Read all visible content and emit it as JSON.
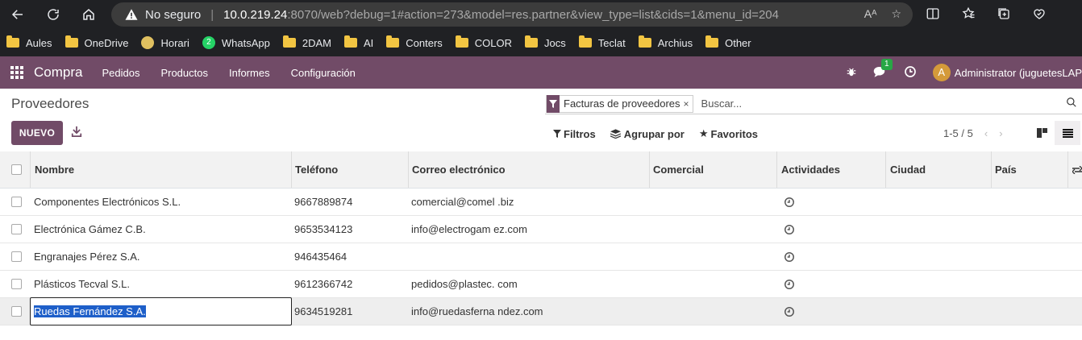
{
  "browser": {
    "security_label": "No seguro",
    "url_host": "10.0.219.24",
    "url_path": ":8070/web?debug=1#action=273&model=res.partner&view_type=list&cids=1&menu_id=204",
    "bookmarks": [
      "Aules",
      "OneDrive",
      "Horari",
      "WhatsApp",
      "2DAM",
      "AI",
      "Conters",
      "COLOR",
      "Jocs",
      "Teclat",
      "Archius",
      "Other"
    ],
    "whatsapp_badge": "2"
  },
  "navbar": {
    "app_name": "Compra",
    "menu": [
      "Pedidos",
      "Productos",
      "Informes",
      "Configuración"
    ],
    "chat_count": "1",
    "avatar_letter": "A",
    "user_name": "Administrator (juguetesLAP"
  },
  "control_panel": {
    "title": "Proveedores",
    "new_button": "NUEVO",
    "facet_label": "Facturas de proveedores",
    "facet_remove": "×",
    "search_placeholder": "Buscar...",
    "filters_label": "Filtros",
    "group_label": "Agrupar por",
    "favorites_label": "Favoritos",
    "pager": "1-5 / 5"
  },
  "table": {
    "columns": [
      "Nombre",
      "Teléfono",
      "Correo electrónico",
      "Comercial",
      "Actividades",
      "Ciudad",
      "País"
    ],
    "rows": [
      {
        "name": "Componentes Electrónicos S.L.",
        "phone": "9667889874",
        "email": "comercial@comel .biz"
      },
      {
        "name": "Electrónica Gámez C.B.",
        "phone": "9653534123",
        "email": "info@electrogam ez.com"
      },
      {
        "name": "Engranajes Pérez S.A.",
        "phone": "946435464",
        "email": ""
      },
      {
        "name": "Plásticos Tecval S.L.",
        "phone": "9612366742",
        "email": "pedidos@plastec. com"
      },
      {
        "name": "Ruedas Fernández S.A.",
        "phone": "9634519281",
        "email": "info@ruedasferna ndez.com"
      }
    ]
  }
}
